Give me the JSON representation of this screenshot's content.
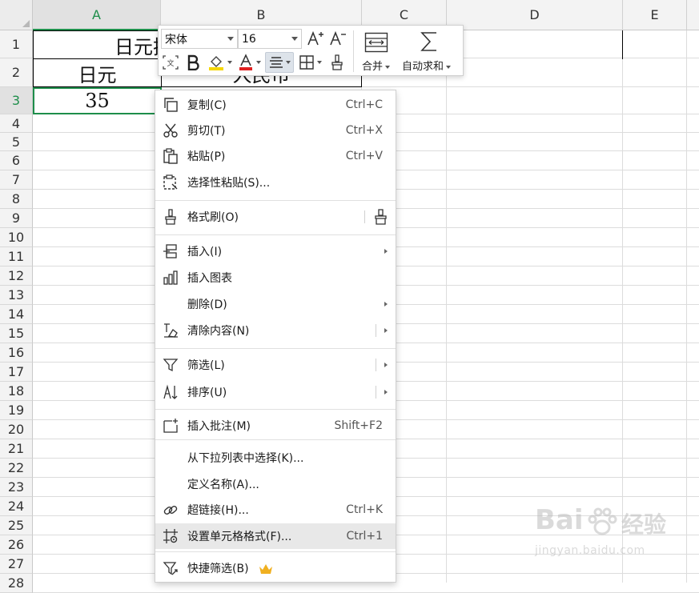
{
  "sheet": {
    "columns": [
      {
        "label": "A",
        "active": true
      },
      {
        "label": "B",
        "active": false
      },
      {
        "label": "C",
        "active": false
      },
      {
        "label": "D",
        "active": false
      },
      {
        "label": "E",
        "active": false
      }
    ],
    "rows": [
      "1",
      "2",
      "3",
      "4",
      "5",
      "6",
      "7",
      "8",
      "9",
      "10",
      "11",
      "12",
      "13",
      "14",
      "15",
      "16",
      "17",
      "18",
      "19",
      "20",
      "21",
      "22",
      "23",
      "24",
      "25",
      "26",
      "27",
      "28"
    ],
    "active_row": "3",
    "cells": {
      "r1_merged": "日元换",
      "a2": "日元",
      "b2": "人民币",
      "a3": "35"
    },
    "accent_color": "#1e8e4b"
  },
  "toolbar": {
    "font_name": "宋体",
    "font_size": "16",
    "merge_label": "合并",
    "autosum_label": "自动求和",
    "font_color": "#e02020",
    "fill_color": "#f5d600"
  },
  "context_menu": {
    "items": [
      {
        "label": "复制(C)",
        "shortcut": "Ctrl+C",
        "icon": "copy-icon"
      },
      {
        "label": "剪切(T)",
        "shortcut": "Ctrl+X",
        "icon": "scissors-icon"
      },
      {
        "label": "粘贴(P)",
        "shortcut": "Ctrl+V",
        "icon": "paste-icon"
      },
      {
        "label": "选择性粘贴(S)...",
        "shortcut": "",
        "icon": "paste-special-icon"
      },
      {
        "label": "格式刷(O)",
        "shortcut": "",
        "icon": "format-painter-icon"
      },
      {
        "label": "插入(I)",
        "shortcut": "",
        "icon": "insert-icon"
      },
      {
        "label": "插入图表",
        "shortcut": "",
        "icon": "bar-chart-icon"
      },
      {
        "label": "删除(D)",
        "shortcut": "",
        "icon": ""
      },
      {
        "label": "清除内容(N)",
        "shortcut": "",
        "icon": "eraser-icon"
      },
      {
        "label": "筛选(L)",
        "shortcut": "",
        "icon": "filter-icon"
      },
      {
        "label": "排序(U)",
        "shortcut": "",
        "icon": "sort-icon"
      },
      {
        "label": "插入批注(M)",
        "shortcut": "Shift+F2",
        "icon": "comment-icon"
      },
      {
        "label": "从下拉列表中选择(K)...",
        "shortcut": "",
        "icon": ""
      },
      {
        "label": "定义名称(A)...",
        "shortcut": "",
        "icon": ""
      },
      {
        "label": "超链接(H)...",
        "shortcut": "Ctrl+K",
        "icon": "link-icon"
      },
      {
        "label": "设置单元格格式(F)...",
        "shortcut": "Ctrl+1",
        "icon": "format-cells-icon"
      },
      {
        "label": "快捷筛选(B)",
        "shortcut": "",
        "icon": "quick-filter-icon"
      }
    ],
    "crown_color": "#f0b020"
  },
  "watermark": {
    "brand_left": "Bai",
    "brand_right": "经验",
    "url": "jingyan.baidu.com"
  }
}
